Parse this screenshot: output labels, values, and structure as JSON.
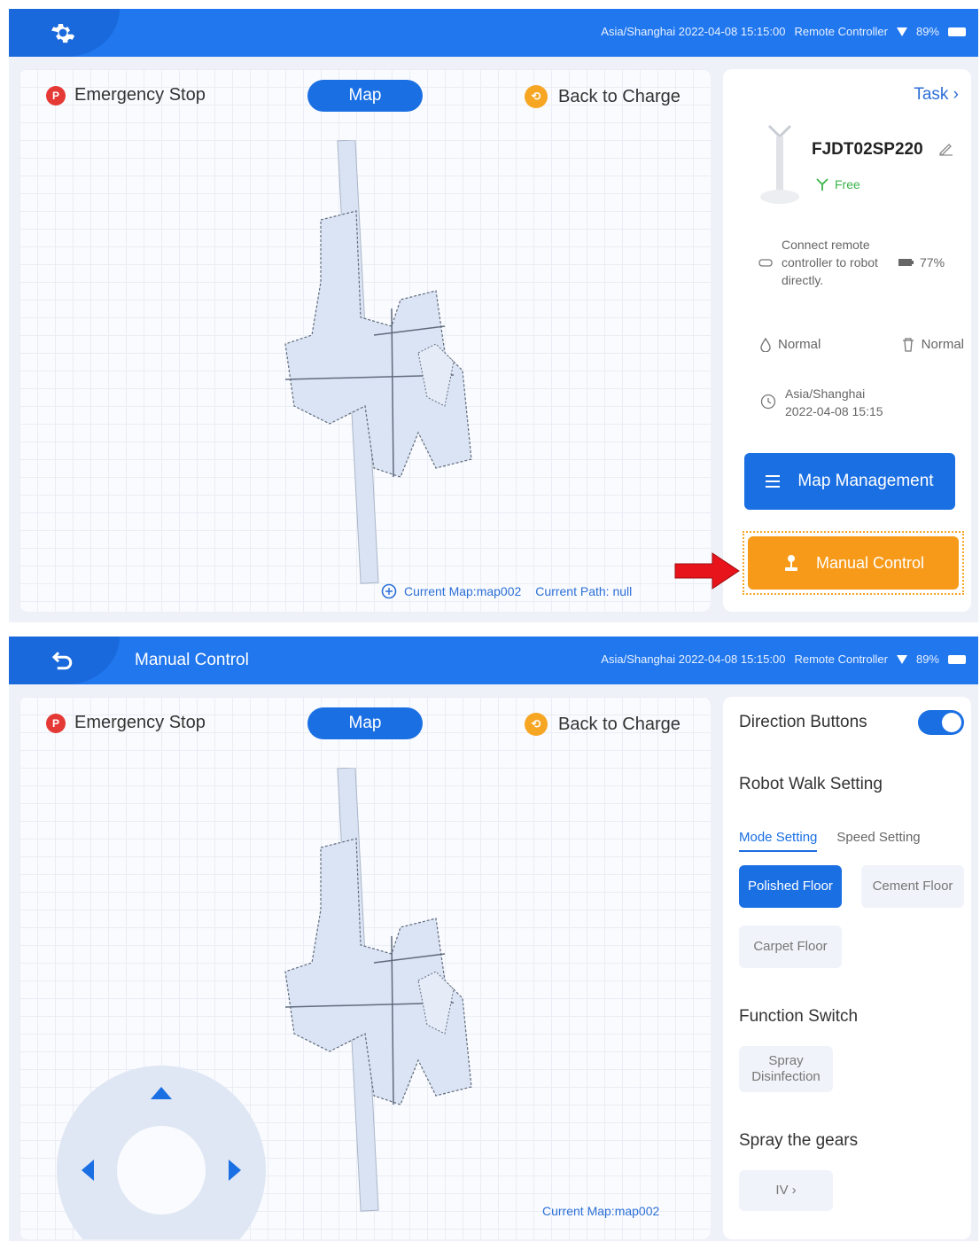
{
  "status_bar": {
    "timezone_time": "Asia/Shanghai 2022-04-08 15:15:00",
    "mode": "Remote Controller",
    "battery": "89%"
  },
  "screen1": {
    "emergency_stop": "Emergency Stop",
    "map_tab": "Map",
    "back_to_charge": "Back to Charge",
    "current_map": "Current Map:map002",
    "current_path": "Current Path:  null",
    "task_link": "Task",
    "robot_name": "FJDT02SP220",
    "robot_state": "Free",
    "connect_text": "Connect remote controller to robot directly.",
    "battery_level": "77%",
    "water_status": "Normal",
    "bin_status": "Normal",
    "robot_timezone": "Asia/Shanghai",
    "robot_time": "2022-04-08 15:15",
    "map_management": "Map Management",
    "manual_control": "Manual Control"
  },
  "screen2": {
    "title": "Manual Control",
    "emergency_stop": "Emergency Stop",
    "map_tab": "Map",
    "back_to_charge": "Back to Charge",
    "current_map": "Current Map:map002",
    "direction_buttons": "Direction Buttons",
    "direction_buttons_on": true,
    "robot_walk_setting": "Robot Walk Setting",
    "tabs": [
      "Mode Setting",
      "Speed Setting"
    ],
    "modes": [
      "Polished Floor",
      "Cement Floor",
      "Carpet Floor"
    ],
    "active_mode": "Polished Floor",
    "function_switch": "Function Switch",
    "function_option": "Spray Disinfection",
    "spray_gears": "Spray the gears",
    "gear_value": "IV"
  },
  "colors": {
    "primary": "#2077ee",
    "orange": "#f79a1a",
    "red": "#e53935",
    "green": "#3cb44b"
  },
  "icons": [
    "gear-icon",
    "back-icon",
    "wifi-icon",
    "battery-icon",
    "map-icon",
    "edit-icon",
    "chevron-right-icon",
    "list-icon",
    "joystick-icon",
    "clock-icon",
    "water-drop-icon",
    "trash-icon",
    "remote-icon"
  ]
}
